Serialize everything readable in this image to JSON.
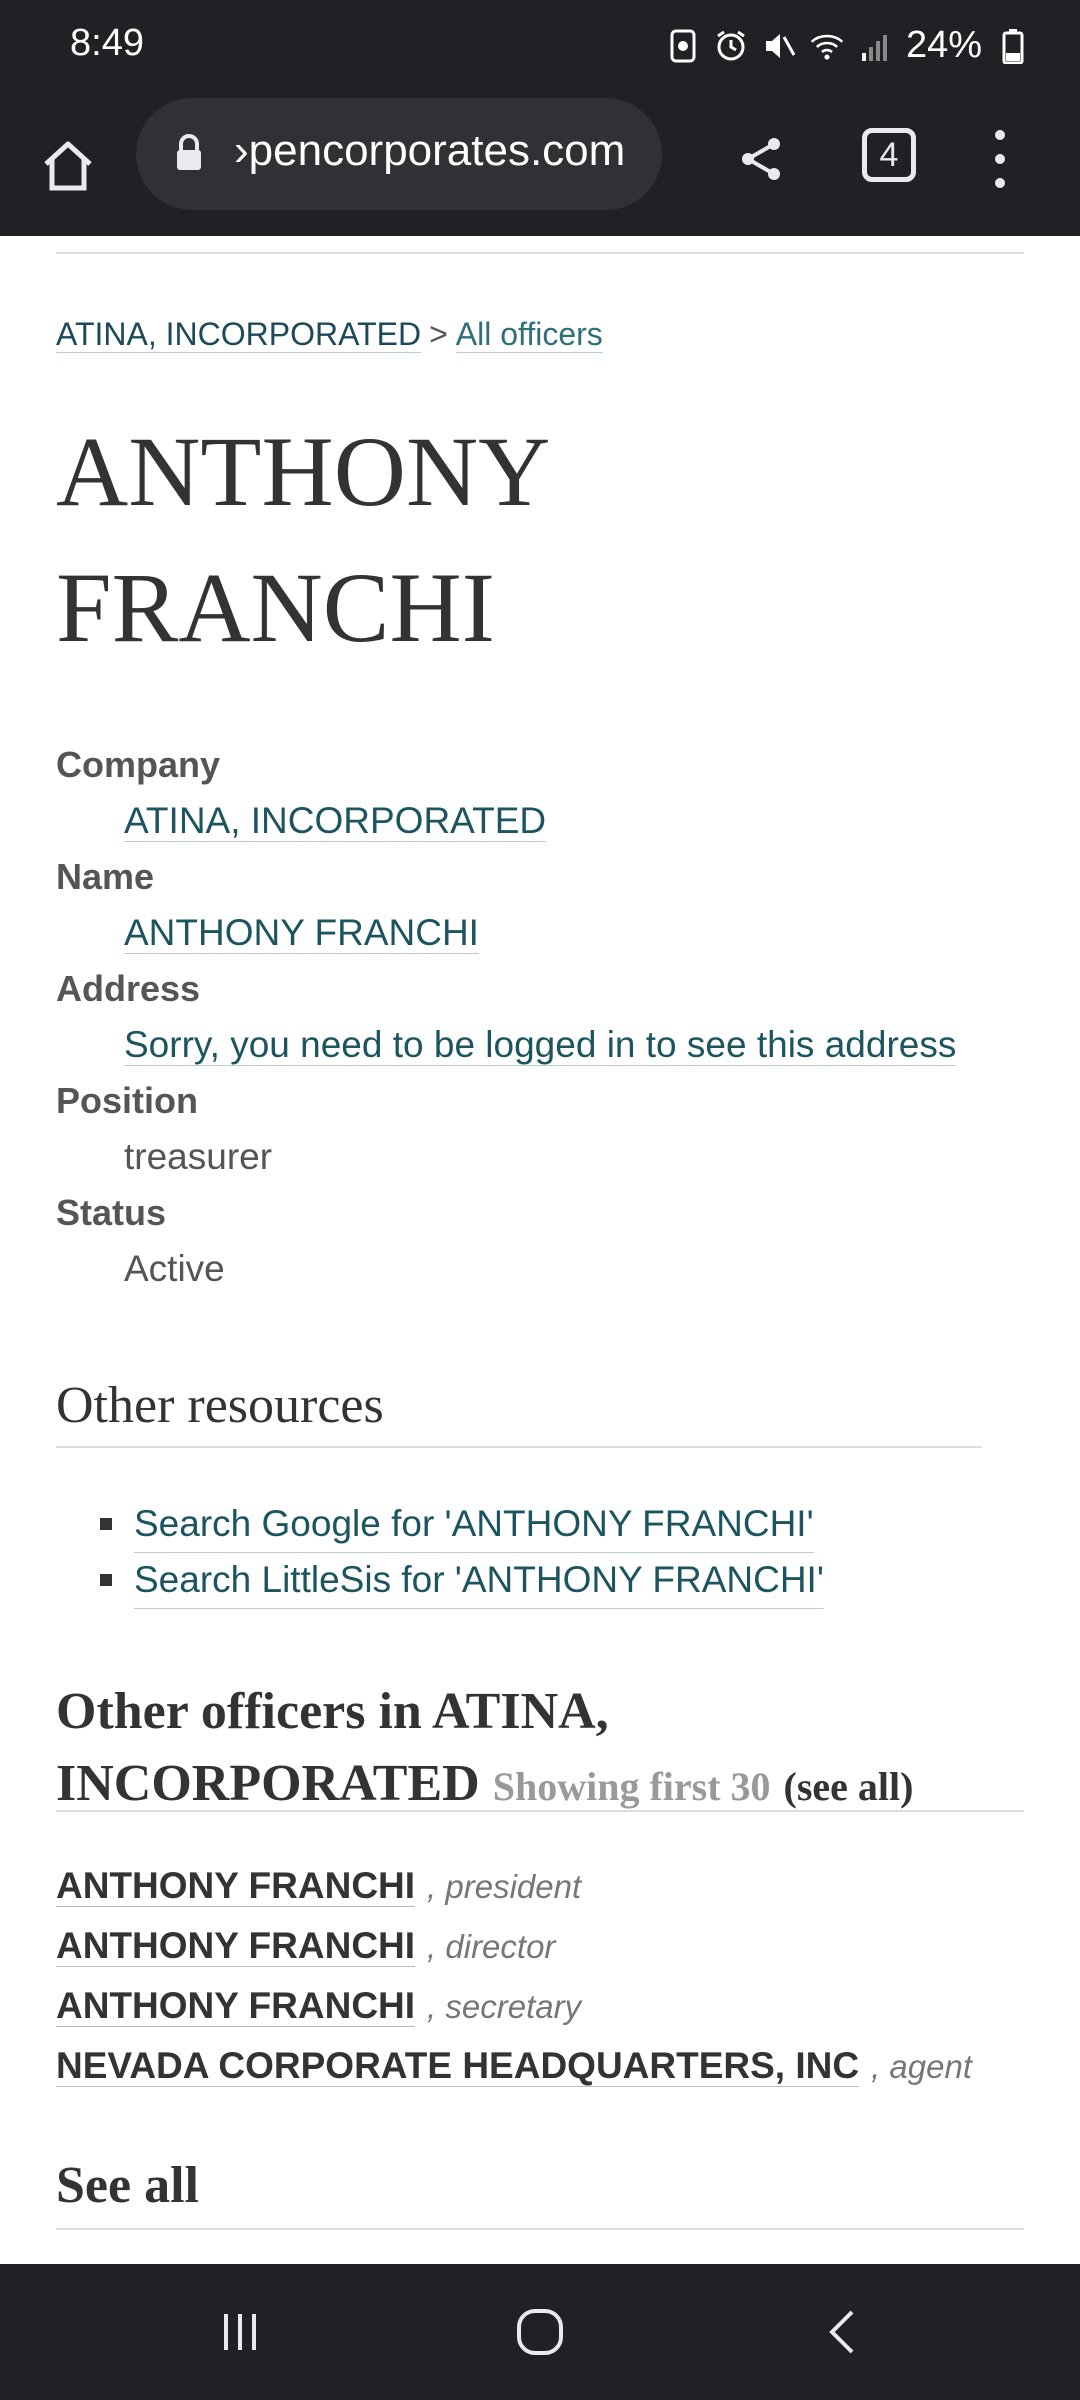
{
  "status_bar": {
    "time": "8:49",
    "battery": "24%"
  },
  "browser": {
    "url": "›pencorporates.com",
    "tab_count": "4"
  },
  "breadcrumb": {
    "company": "ATINA, INCORPORATED",
    "separator": ">",
    "all_officers": "All officers"
  },
  "officer": {
    "title": "ANTHONY FRANCHI",
    "fields": {
      "company_label": "Company",
      "company_value": "ATINA, INCORPORATED",
      "name_label": "Name",
      "name_value": "ANTHONY FRANCHI",
      "address_label": "Address",
      "address_value": "Sorry, you need to be logged in to see this address",
      "position_label": "Position",
      "position_value": "treasurer",
      "status_label": "Status",
      "status_value": "Active"
    }
  },
  "other_resources": {
    "heading": "Other resources",
    "items": [
      "Search Google for 'ANTHONY FRANCHI'",
      "Search LittleSis for 'ANTHONY FRANCHI'"
    ]
  },
  "other_officers": {
    "heading": "Other officers in ATINA, INCORPORATED",
    "meta": "Showing first 30",
    "see_all": "see all",
    "rows": [
      {
        "name": "ANTHONY FRANCHI",
        "role": ", president"
      },
      {
        "name": "ANTHONY FRANCHI",
        "role": ", director"
      },
      {
        "name": "ANTHONY FRANCHI",
        "role": ", secretary"
      },
      {
        "name": "NEVADA CORPORATE HEADQUARTERS, INC",
        "role": ", agent"
      }
    ]
  },
  "see_all_heading": "See all",
  "colors": {
    "chrome": "#202124",
    "link": "#1c5560",
    "text": "#333333"
  }
}
